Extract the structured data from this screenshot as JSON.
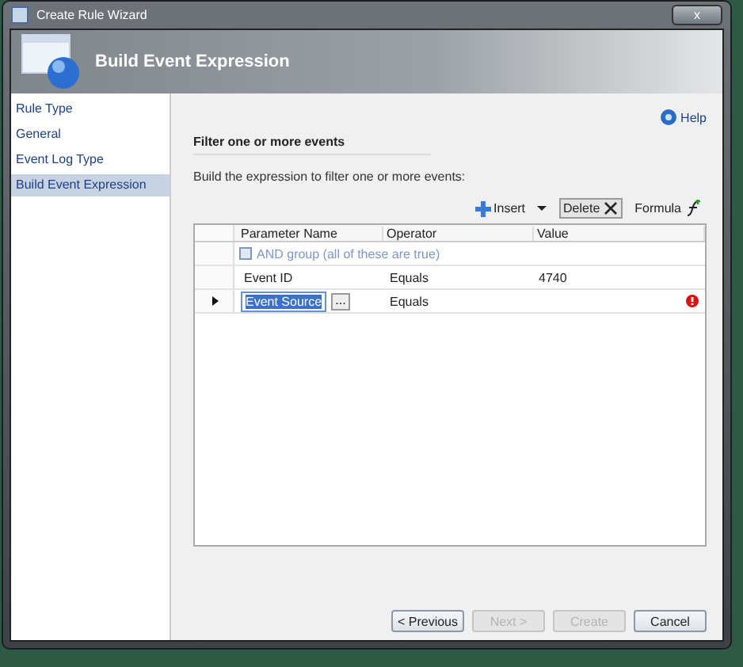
{
  "window": {
    "title": "Create Rule Wizard",
    "close": "x"
  },
  "header": {
    "title": "Build Event Expression"
  },
  "sidebar": {
    "items": [
      {
        "label": "Rule Type",
        "selected": false
      },
      {
        "label": "General",
        "selected": false
      },
      {
        "label": "Event Log Type",
        "selected": false
      },
      {
        "label": "Build Event Expression",
        "selected": true
      }
    ]
  },
  "help": "Help",
  "section_title": "Filter one or more events",
  "instruction": "Build the expression to filter one or more events:",
  "toolbar": {
    "insert": "Insert",
    "delete": "Delete",
    "formula": "Formula"
  },
  "table": {
    "columns": [
      "Parameter Name",
      "Operator",
      "Value"
    ],
    "group": {
      "label": "AND group (all of these are true)",
      "expanded": true
    },
    "rows": [
      {
        "parameter": "Event ID",
        "operator": "Equals",
        "value": "4740",
        "current": false
      },
      {
        "parameter": "Event Source",
        "operator": "Equals",
        "current": true,
        "editing": true,
        "browse": "...",
        "error": true
      }
    ]
  },
  "buttons": [
    {
      "label": "< Previous",
      "disabled": false
    },
    {
      "label": "Next >",
      "disabled": true
    },
    {
      "label": "Create",
      "disabled": true
    },
    {
      "label": "Cancel",
      "disabled": false
    }
  ]
}
